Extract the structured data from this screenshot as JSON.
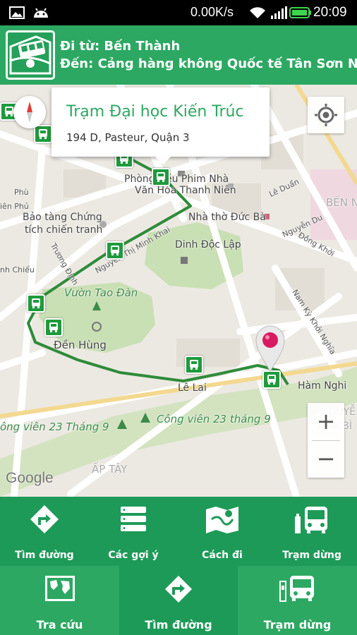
{
  "status_bar": {
    "speed": "0.00K/s",
    "time": "20:09",
    "icons": [
      "image-icon",
      "android-icon",
      "wifi-icon",
      "signal-icon",
      "battery-icon"
    ]
  },
  "header": {
    "from_label": "Đi từ: Bến Thành",
    "to_label": "Đến: Cảng hàng không Quốc tế Tân Sơn Nhất",
    "logo_icon": "bus-route-icon"
  },
  "map": {
    "popup": {
      "title": "Trạm Đại học Kiến Trúc",
      "address": "194 D, Pasteur, Quận 3"
    },
    "labels": {
      "phong": "Phòng",
      "phim_nha": "ều Phim Nhà",
      "van_hoa": "Văn Hóa Thanh Niên",
      "bao_tang_1": "Bảo tàng Chứng",
      "bao_tang_2": "tích chiến tranh",
      "nha_tho": "Nhà thờ Đức Bà",
      "dinh": "Dinh Độc Lập",
      "vuon_tao_dan": "Vườn Tao Đàn",
      "den_hung": "Đền Hùng",
      "le_lai": "Lê Lai",
      "ham_nghi": "Hàm Nghi",
      "cong_vien_left": "ông viên 23 Tháng 9",
      "cong_vien_right": "Công viên 23 tháng 9",
      "ap_tay": "ẤP TÂY",
      "ben_n": "BẾN N",
      "le_duan": "Lê Duẩn",
      "nguyen_du": "Nguyễn Du",
      "dong_khoi": "Đồng Khởi",
      "nam_ky": "Nam Kỳ Khởi Nghĩa",
      "truong_dinh": "Trương Định",
      "nguyen_thi_minh_khai": "Nguyễn Thị Minh Khai",
      "phu": "Phù",
      "bien_phu": "iên Phủ",
      "nh_chieu": "nh Chiểu",
      "nguye": "NGUYỄ",
      "thai_bi": "THÁI BÌ"
    },
    "google_logo": "Google",
    "zoom_in": "+",
    "zoom_out": "−",
    "route_color": "#2e8b3a",
    "stop_color": "#1f9a3c"
  },
  "tabs_top": [
    {
      "label": "Tìm đường",
      "icon": "directions-icon"
    },
    {
      "label": "Các gợi ý",
      "icon": "list-icon"
    },
    {
      "label": "Cách đi",
      "icon": "map-icon"
    },
    {
      "label": "Trạm dừng",
      "icon": "bus-stop-icon"
    }
  ],
  "tabs_bottom": [
    {
      "label": "Tra cứu",
      "icon": "world-map-icon"
    },
    {
      "label": "Tìm đường",
      "icon": "directions-icon",
      "active": true
    },
    {
      "label": "Trạm dừng",
      "icon": "bus-stop-icon"
    }
  ],
  "colors": {
    "primary": "#2ca862",
    "primary_dark": "#1e9a58",
    "status_bg": "#000000"
  }
}
